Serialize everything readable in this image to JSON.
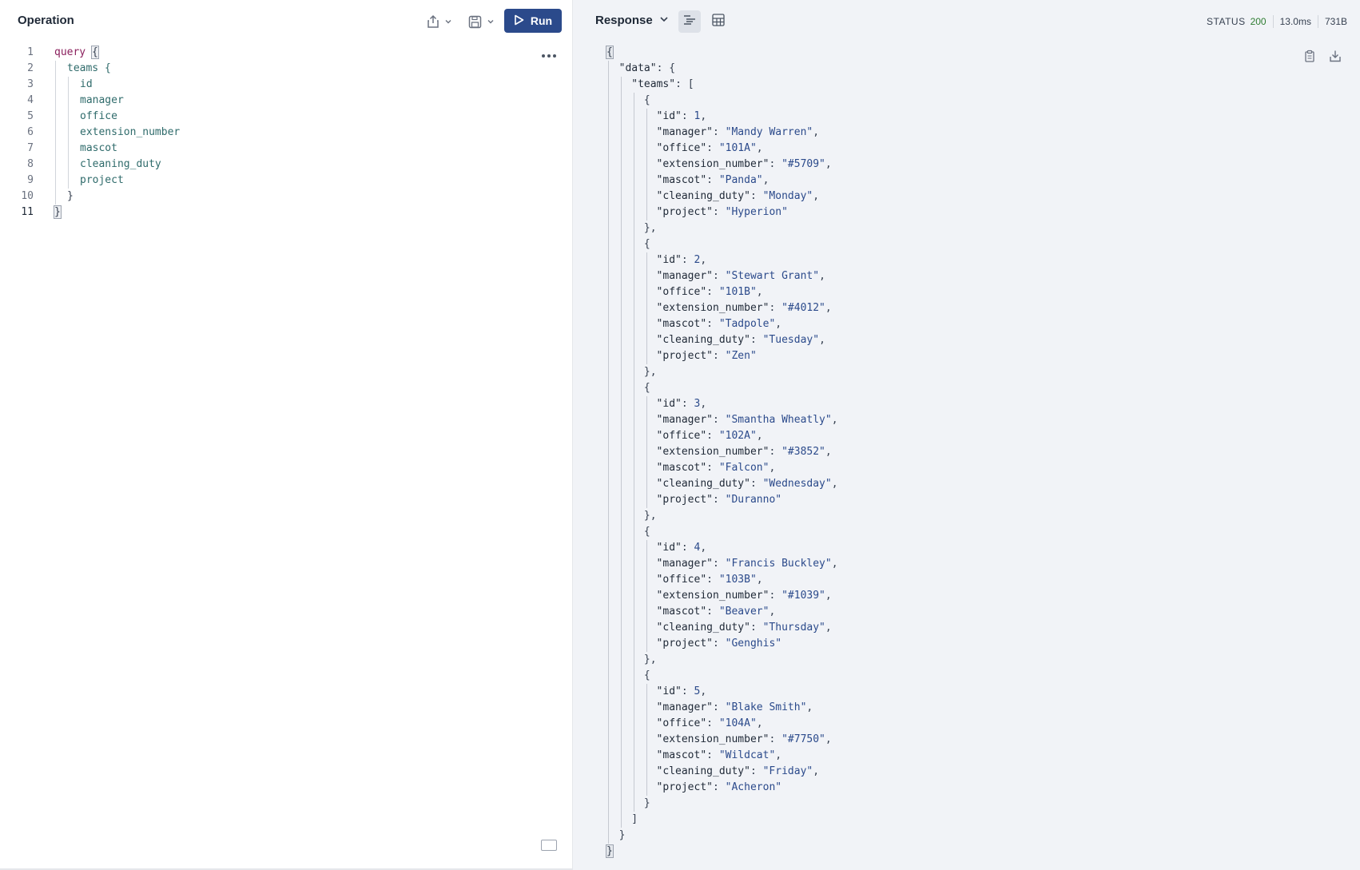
{
  "operation": {
    "title": "Operation",
    "run_label": "Run",
    "lines": [
      {
        "n": "1",
        "text": "query {"
      },
      {
        "n": "2",
        "text": "teams {"
      },
      {
        "n": "3",
        "text": "id"
      },
      {
        "n": "4",
        "text": "manager"
      },
      {
        "n": "5",
        "text": "office"
      },
      {
        "n": "6",
        "text": "extension_number"
      },
      {
        "n": "7",
        "text": "mascot"
      },
      {
        "n": "8",
        "text": "cleaning_duty"
      },
      {
        "n": "9",
        "text": "project"
      },
      {
        "n": "10",
        "text": "}"
      },
      {
        "n": "11",
        "text": "}"
      }
    ],
    "icons": {
      "share": "share-icon",
      "save": "save-icon",
      "run": "play-icon",
      "more": "more-horizontal-icon",
      "keyboard": "keyboard-icon"
    }
  },
  "response": {
    "title": "Response",
    "status_label": "STATUS",
    "status_code": "200",
    "time": "13.0ms",
    "size": "731B",
    "icons": {
      "pretty": "text-view-icon",
      "table": "table-view-icon",
      "copy": "clipboard-icon",
      "download": "download-icon"
    },
    "teams": [
      {
        "id": "1",
        "manager": "Mandy Warren",
        "office": "101A",
        "extension_number": "#5709",
        "mascot": "Panda",
        "cleaning_duty": "Monday",
        "project": "Hyperion"
      },
      {
        "id": "2",
        "manager": "Stewart Grant",
        "office": "101B",
        "extension_number": "#4012",
        "mascot": "Tadpole",
        "cleaning_duty": "Tuesday",
        "project": "Zen"
      },
      {
        "id": "3",
        "manager": "Smantha Wheatly",
        "office": "102A",
        "extension_number": "#3852",
        "mascot": "Falcon",
        "cleaning_duty": "Wednesday",
        "project": "Duranno"
      },
      {
        "id": "4",
        "manager": "Francis Buckley",
        "office": "103B",
        "extension_number": "#1039",
        "mascot": "Beaver",
        "cleaning_duty": "Thursday",
        "project": "Genghis"
      },
      {
        "id": "5",
        "manager": "Blake Smith",
        "office": "104A",
        "extension_number": "#7750",
        "mascot": "Wildcat",
        "cleaning_duty": "Friday",
        "project": "Acheron"
      }
    ]
  },
  "colors": {
    "run_button": "#2b4a8b",
    "status_ok": "#2f7d32",
    "response_bg": "#f1f3f7"
  }
}
